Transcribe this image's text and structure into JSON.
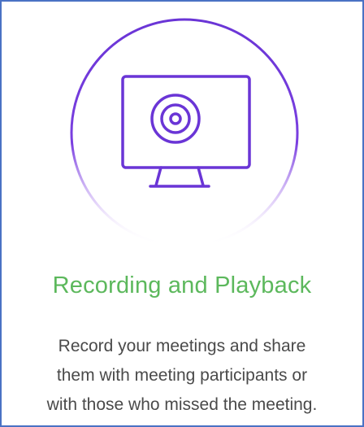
{
  "card": {
    "title": "Recording and Playback",
    "description_lines": [
      "Record your meetings and share",
      "them with meeting participants or",
      "with those who missed the meeting."
    ],
    "icon": "monitor-record-icon",
    "colors": {
      "border": "#4a72c4",
      "title": "#5cb85c",
      "icon_stroke": "#6a35d6",
      "text": "#4a4a4a"
    }
  }
}
